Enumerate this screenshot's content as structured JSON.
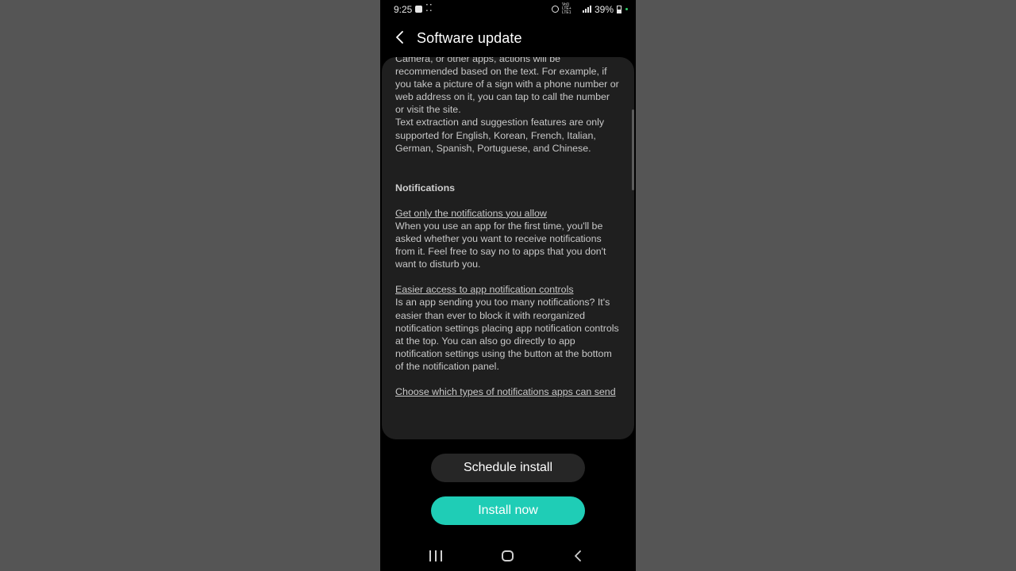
{
  "status_bar": {
    "time": "9:25",
    "dots": "⁚⁚",
    "network_label": "Vo)) LTE+ LTE1",
    "battery_percent": "39%",
    "icons": [
      "notification-icon",
      "alarm-icon",
      "signal-icon",
      "battery-icon"
    ]
  },
  "header": {
    "back_icon": "chevron-left-icon",
    "title": "Software update"
  },
  "content": {
    "paragraph_1": "Camera, or other apps, actions will be recommended based on the text. For example, if you take a picture of a sign with a phone number or web address on it, you can tap to call the number or visit the site.",
    "paragraph_2": "Text extraction and suggestion features are only supported for English, Korean, French, Italian, German, Spanish, Portuguese, and Chinese.",
    "section_heading": "Notifications",
    "items": [
      {
        "title": "Get only the notifications you allow",
        "body": "When you use an app for the first time, you'll be asked whether you want to receive notifications from it. Feel free to say no to apps that you don't want to disturb you."
      },
      {
        "title": "Easier access to app notification controls",
        "body": "Is an app sending you too many notifications? It's easier than ever to block it with reorganized notification settings placing app notification controls at the top. You can also go directly to app notification settings using the button at the bottom of the notification panel."
      },
      {
        "title": "Choose which types of notifications apps can send",
        "body": ""
      }
    ]
  },
  "actions": {
    "schedule_label": "Schedule install",
    "install_label": "Install now",
    "install_color": "#1fcdb6"
  },
  "nav_bar": {
    "icons": [
      "recents-icon",
      "home-icon",
      "back-icon"
    ]
  }
}
